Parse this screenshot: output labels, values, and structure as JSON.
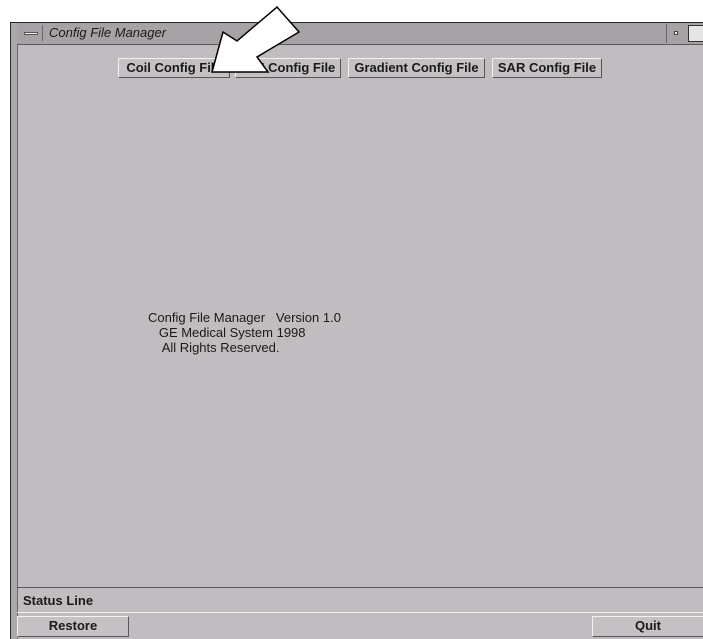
{
  "window": {
    "title": "Config File Manager"
  },
  "toolbar": {
    "buttons": [
      {
        "label": "Coil Config File"
      },
      {
        "label": "MRI Config File"
      },
      {
        "label": "Gradient Config File"
      },
      {
        "label": "SAR Config File"
      }
    ]
  },
  "about": {
    "line1": "Config File Manager   Version 1.0",
    "line2": "   GE Medical System 1998",
    "line3": "    All Rights Reserved."
  },
  "status": {
    "label": "Status Line"
  },
  "footer": {
    "restore_label": "Restore",
    "quit_label": "Quit"
  },
  "icons": {
    "window_menu": "window-menu-icon",
    "minimize": "minimize-icon",
    "maximize": "maximize-icon",
    "pointer_arrow": "arrow-pointer-icon"
  },
  "colors": {
    "window_bg": "#c0bcc0",
    "titlebar_bg": "#a6a2a6",
    "text": "#1a1a1a"
  }
}
